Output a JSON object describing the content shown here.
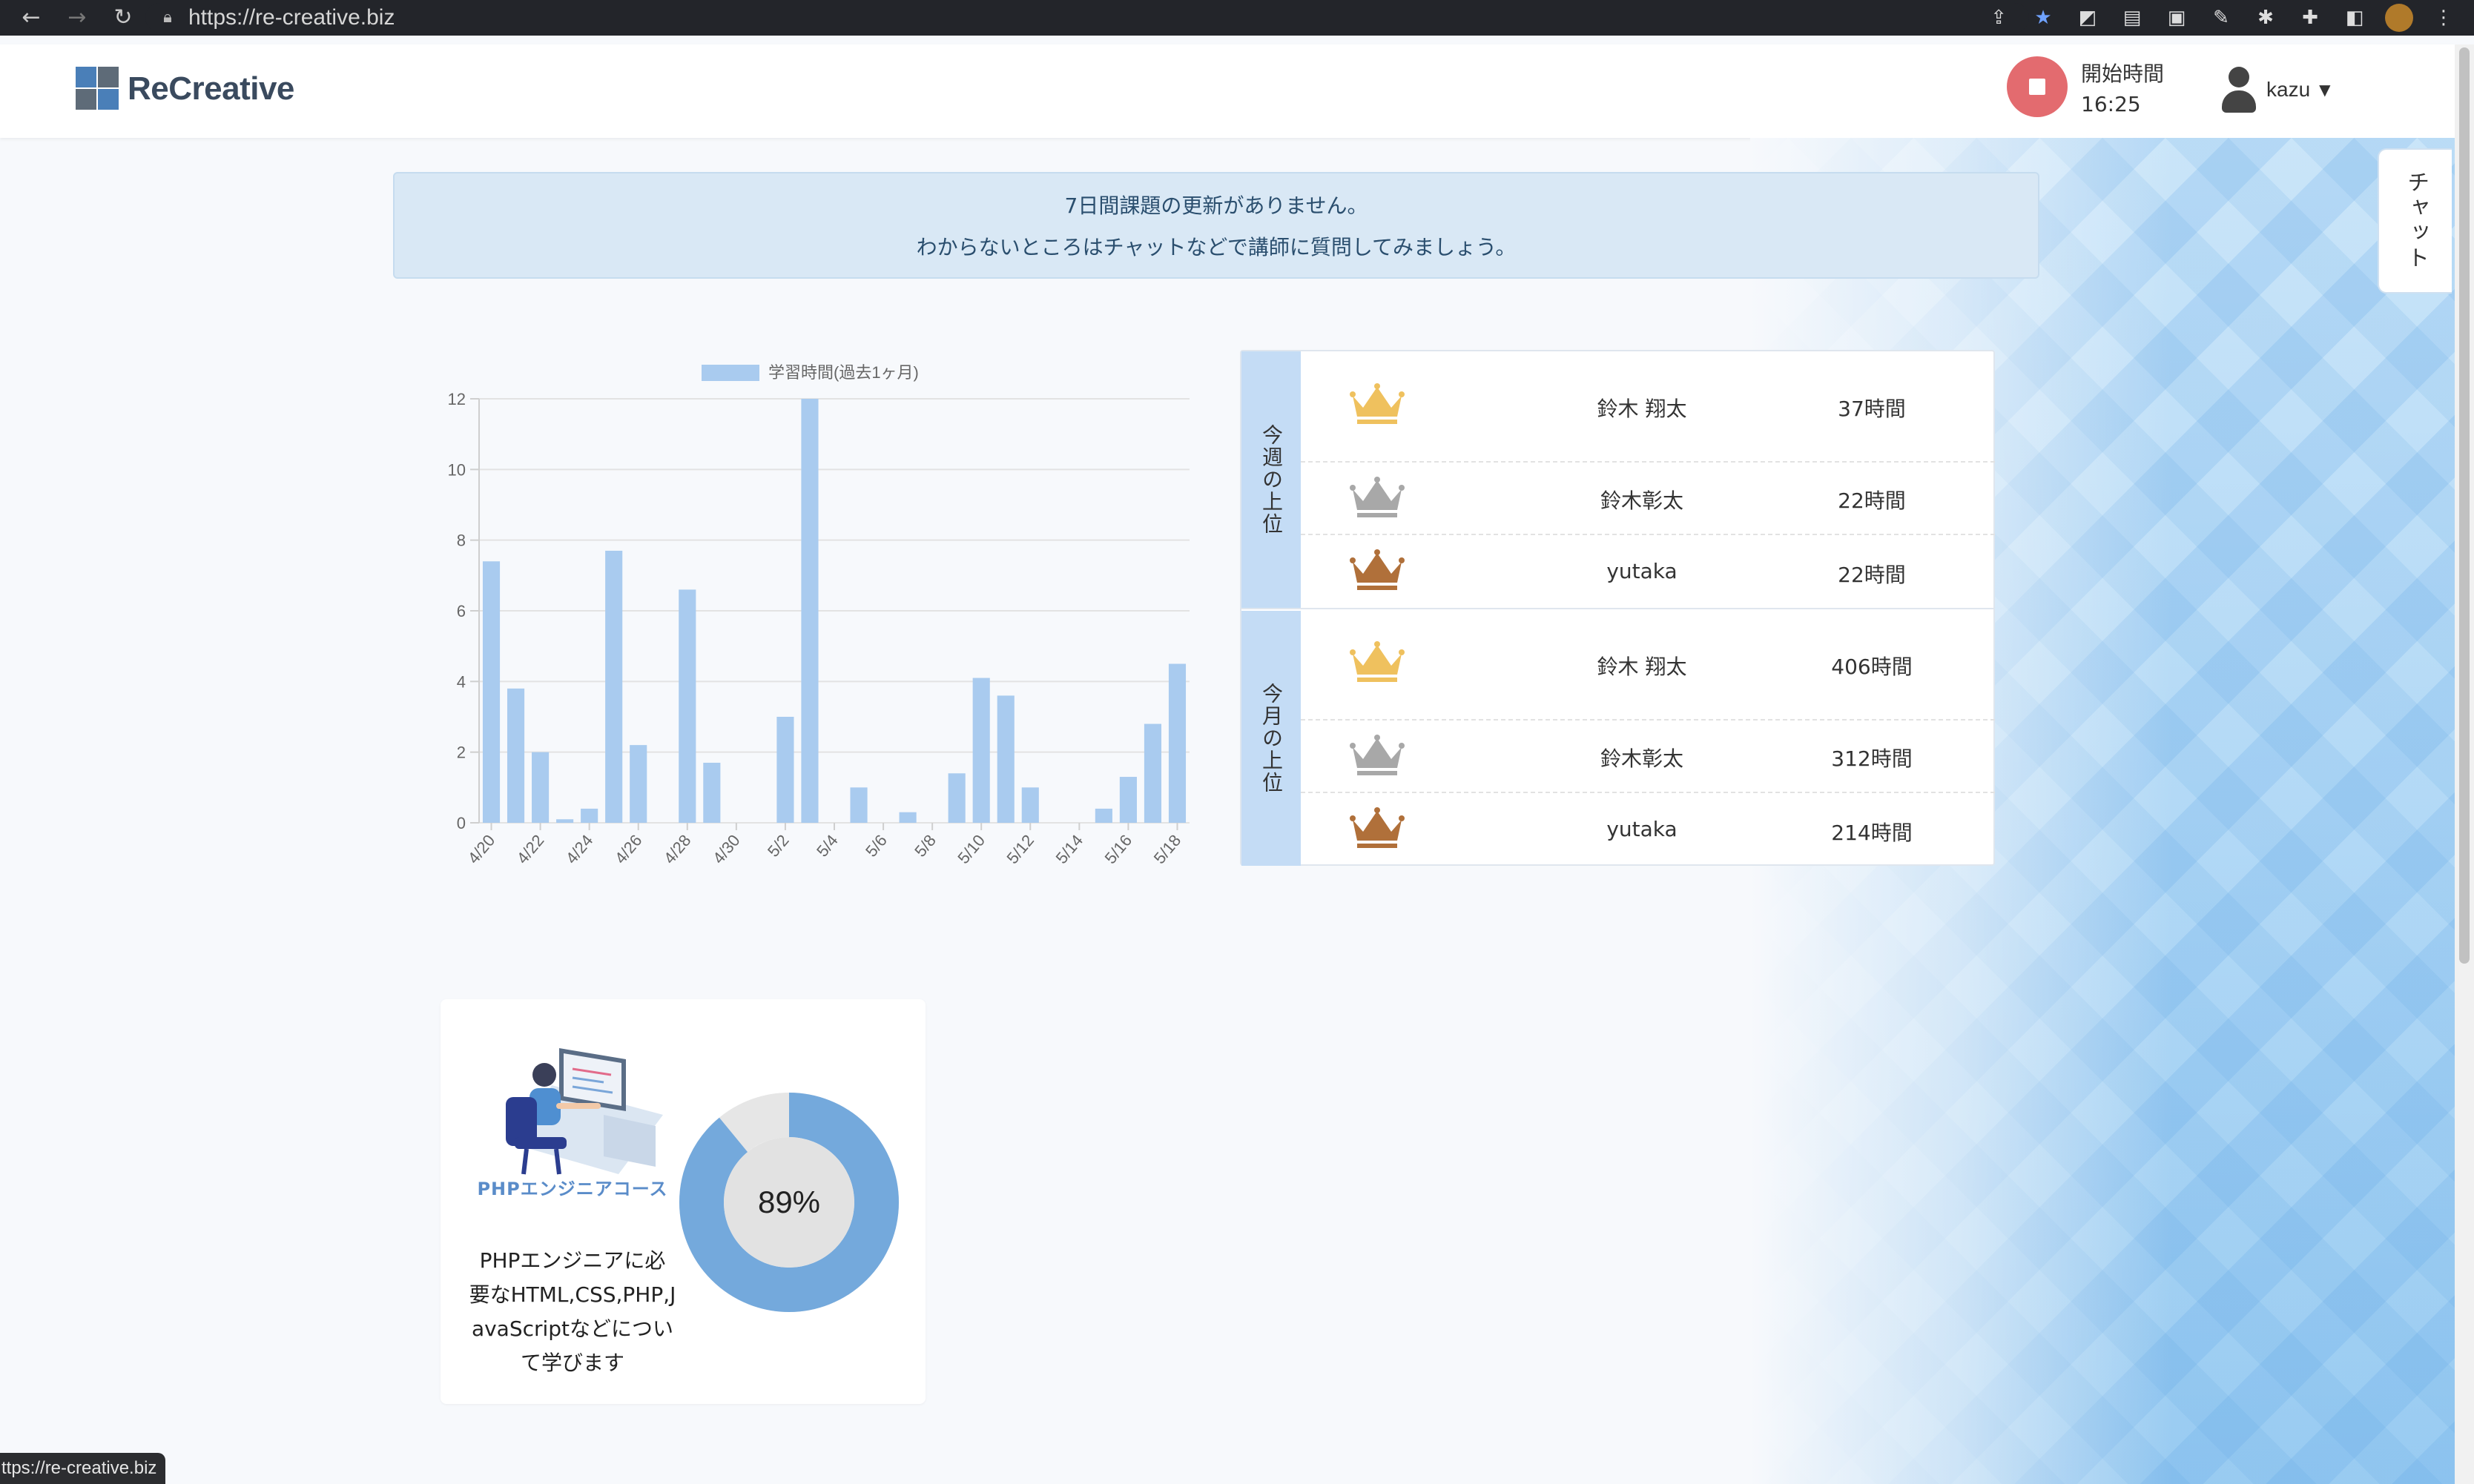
{
  "browser": {
    "url": "https://re-creative.biz",
    "status_url": "ttps://re-creative.biz",
    "nav_icons": [
      "back-arrow-icon",
      "forward-arrow-icon",
      "reload-icon"
    ]
  },
  "header": {
    "logo_text": "ReCreative",
    "start_label": "開始時間",
    "start_time": "16:25",
    "user_name": "kazu"
  },
  "chat_tab": {
    "label": "チャット"
  },
  "alert": {
    "line1": "7日間課題の更新がありません。",
    "line2": "わからないところはチャットなどで講師に質問してみましょう。"
  },
  "chart_data": {
    "type": "bar",
    "title": "",
    "legend": [
      "学習時間(過去1ヶ月)"
    ],
    "series": [
      {
        "name": "学習時間(過去1ヶ月)",
        "values": [
          7.4,
          3.8,
          2.0,
          0.1,
          0.4,
          7.7,
          2.2,
          0,
          6.6,
          1.7,
          0,
          0,
          3.0,
          12.0,
          0,
          1.0,
          0,
          0.3,
          0,
          1.4,
          4.1,
          3.6,
          1.0,
          0,
          0,
          0.4,
          1.3,
          2.8,
          4.5
        ]
      }
    ],
    "categories": [
      "4/20",
      "4/21",
      "4/22",
      "4/23",
      "4/24",
      "4/25",
      "4/26",
      "4/27",
      "4/28",
      "4/29",
      "4/30",
      "5/1",
      "5/2",
      "5/3",
      "5/4",
      "5/5",
      "5/6",
      "5/7",
      "5/8",
      "5/9",
      "5/10",
      "5/11",
      "5/12",
      "5/13",
      "5/14",
      "5/15",
      "5/16",
      "5/17",
      "5/18"
    ],
    "tick_labels": [
      "4/20",
      "4/22",
      "4/24",
      "4/26",
      "4/28",
      "4/30",
      "5/2",
      "5/4",
      "5/6",
      "5/8",
      "5/10",
      "5/12",
      "5/14",
      "5/16",
      "5/18"
    ],
    "ylim": [
      0,
      12
    ],
    "yticks": [
      "0",
      "2",
      "4",
      "6",
      "8",
      "10",
      "12"
    ],
    "bar_color": "#a9cbef",
    "grid": true,
    "legend_position": "top"
  },
  "ranking": {
    "weekly": {
      "label": "今週の上位",
      "rows": [
        {
          "name": "鈴木 翔太",
          "hours": "37時間",
          "crown": "gold-crown-icon"
        },
        {
          "name": "鈴木彰太",
          "hours": "22時間",
          "crown": "silver-crown-icon"
        },
        {
          "name": "yutaka",
          "hours": "22時間",
          "crown": "bronze-crown-icon"
        }
      ]
    },
    "monthly": {
      "label": "今月の上位",
      "rows": [
        {
          "name": "鈴木 翔太",
          "hours": "406時間",
          "crown": "gold-crown-icon"
        },
        {
          "name": "鈴木彰太",
          "hours": "312時間",
          "crown": "silver-crown-icon"
        },
        {
          "name": "yutaka",
          "hours": "214時間",
          "crown": "bronze-crown-icon"
        }
      ]
    },
    "crown_colors": {
      "gold": "#efc15e",
      "silver": "#a8a8a8",
      "bronze": "#b0703a"
    }
  },
  "course": {
    "title": "PHPエンジニアコース",
    "desc_lines": [
      "PHPエンジニアに必",
      "要なHTML,CSS,PHP,J",
      "avaScriptなどについ",
      "て学びます"
    ],
    "progress_label": "89%",
    "progress": 0.89,
    "progress_color": "#74a9dc"
  }
}
